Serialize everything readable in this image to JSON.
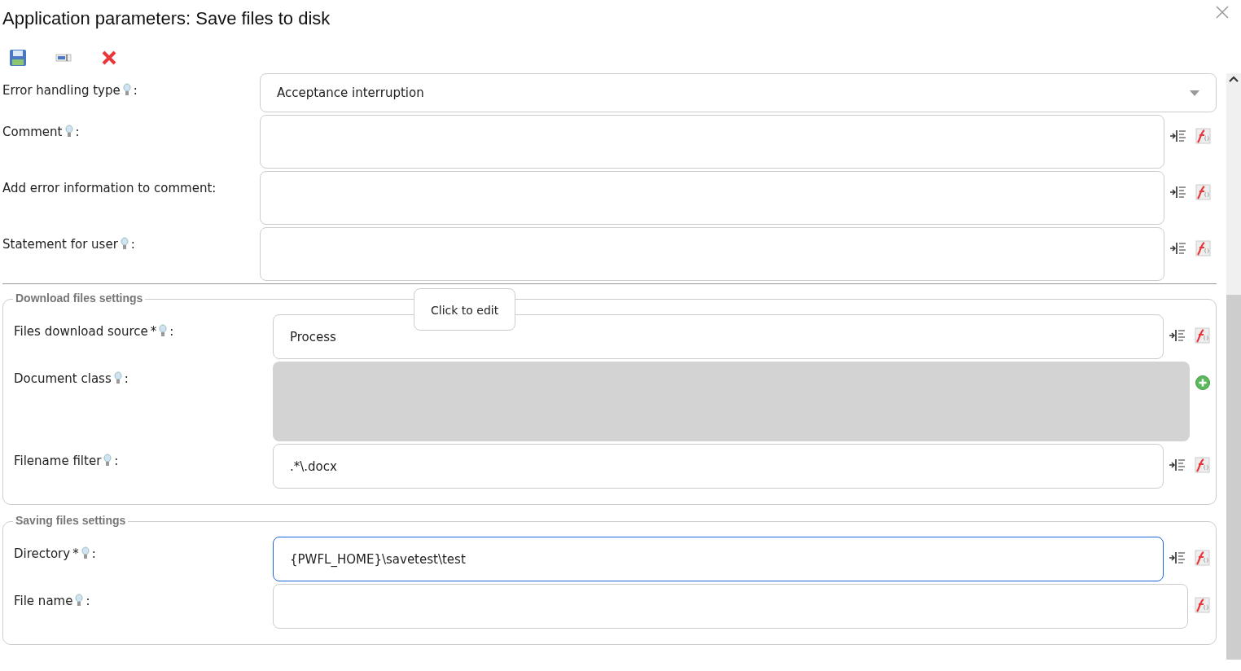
{
  "window": {
    "title": "Application parameters: Save files to disk"
  },
  "toolbar": [
    {
      "kind": "save"
    },
    {
      "kind": "field"
    },
    {
      "kind": "delete"
    }
  ],
  "fields": [
    {
      "label": "Error handling type",
      "hint": true,
      "colon": ":",
      "kind": "select",
      "value": "Acceptance interruption"
    },
    {
      "label": "Comment",
      "hint": true,
      "colon": ":",
      "kind": "textarea",
      "actions": [
        {
          "kind": "insert"
        },
        {
          "kind": "function"
        }
      ]
    },
    {
      "label": "Add error information to comment:",
      "hint": false,
      "kind": "textarea",
      "actions": [
        {
          "kind": "insert"
        },
        {
          "kind": "function"
        }
      ]
    },
    {
      "label": "Statement for user",
      "hint": true,
      "colon": ":",
      "kind": "textarea",
      "actions": [
        {
          "kind": "insert"
        },
        {
          "kind": "function"
        }
      ]
    }
  ],
  "groups": [
    {
      "legend": "Download files settings",
      "tooltip": "Click to edit",
      "fields": [
        {
          "label": "Files download source",
          "required_mark": "*",
          "hint": true,
          "colon": ":",
          "kind": "text",
          "value": "Process",
          "focused": false,
          "actions": [
            {
              "kind": "insert"
            },
            {
              "kind": "function"
            }
          ]
        },
        {
          "label": "Document class",
          "hint": true,
          "colon": ":",
          "kind": "list",
          "actions": [
            {
              "kind": "add"
            }
          ]
        },
        {
          "label": "Filename filter",
          "hint": true,
          "colon": ":",
          "kind": "text",
          "value": ".*\\.docx",
          "focused": false,
          "actions": [
            {
              "kind": "insert"
            },
            {
              "kind": "function"
            }
          ]
        }
      ]
    },
    {
      "legend": "Saving files settings",
      "fields": [
        {
          "label": "Directory",
          "required_mark": "*",
          "hint": true,
          "colon": ":",
          "kind": "text",
          "value": "{PWFL_HOME}\\savetest\\test",
          "focused": true,
          "actions": [
            {
              "kind": "insert"
            },
            {
              "kind": "function"
            }
          ]
        },
        {
          "label": "File name",
          "hint": true,
          "colon": ":",
          "kind": "text",
          "focused": false,
          "actions": [
            {
              "kind": "function"
            }
          ]
        }
      ]
    }
  ]
}
